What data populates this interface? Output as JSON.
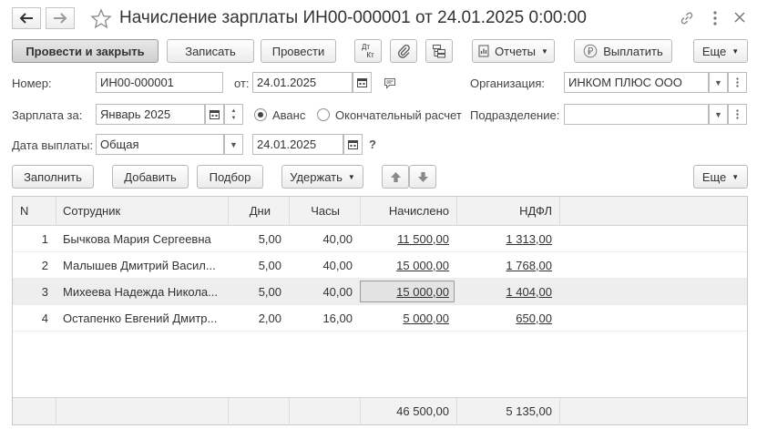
{
  "window": {
    "title": "Начисление зарплаты ИН00-000001 от 24.01.2025 0:00:00"
  },
  "toolbar": {
    "post_close": "Провести и закрыть",
    "save": "Записать",
    "post": "Провести",
    "dt_kt_top": "Дт",
    "dt_kt_bottom": "Кт",
    "reports": "Отчеты",
    "pay": "Выплатить",
    "more": "Еще"
  },
  "form": {
    "number_label": "Номер:",
    "number_value": "ИН00-000001",
    "from_label": "от:",
    "date_value": "24.01.2025",
    "org_label": "Организация:",
    "org_value": "ИНКОМ ПЛЮС ООО",
    "salary_for_label": "Зарплата за:",
    "salary_for_value": "Январь 2025",
    "advance_label": "Аванс",
    "final_label": "Окончательный расчет",
    "dept_label": "Подразделение:",
    "dept_value": "",
    "pay_date_label": "Дата выплаты:",
    "pay_date_type": "Общая",
    "pay_date_value": "24.01.2025",
    "help_mark": "?"
  },
  "table_toolbar": {
    "fill": "Заполнить",
    "add": "Добавить",
    "select": "Подбор",
    "withhold": "Удержать",
    "more": "Еще"
  },
  "table": {
    "headers": {
      "n": "N",
      "employee": "Сотрудник",
      "days": "Дни",
      "hours": "Часы",
      "accrued": "Начислено",
      "ndfl": "НДФЛ"
    },
    "rows": [
      {
        "n": "1",
        "employee": "Бычкова Мария Сергеевна",
        "days": "5,00",
        "hours": "40,00",
        "accrued": "11 500,00",
        "ndfl": "1 313,00"
      },
      {
        "n": "2",
        "employee": "Малышев Дмитрий Васил...",
        "days": "5,00",
        "hours": "40,00",
        "accrued": "15 000,00",
        "ndfl": "1 768,00"
      },
      {
        "n": "3",
        "employee": "Михеева Надежда Никола...",
        "days": "5,00",
        "hours": "40,00",
        "accrued": "15 000,00",
        "ndfl": "1 404,00"
      },
      {
        "n": "4",
        "employee": "Остапенко Евгений Дмитр...",
        "days": "2,00",
        "hours": "16,00",
        "accrued": "5 000,00",
        "ndfl": "650,00"
      }
    ],
    "totals": {
      "accrued": "46 500,00",
      "ndfl": "5 135,00"
    }
  }
}
